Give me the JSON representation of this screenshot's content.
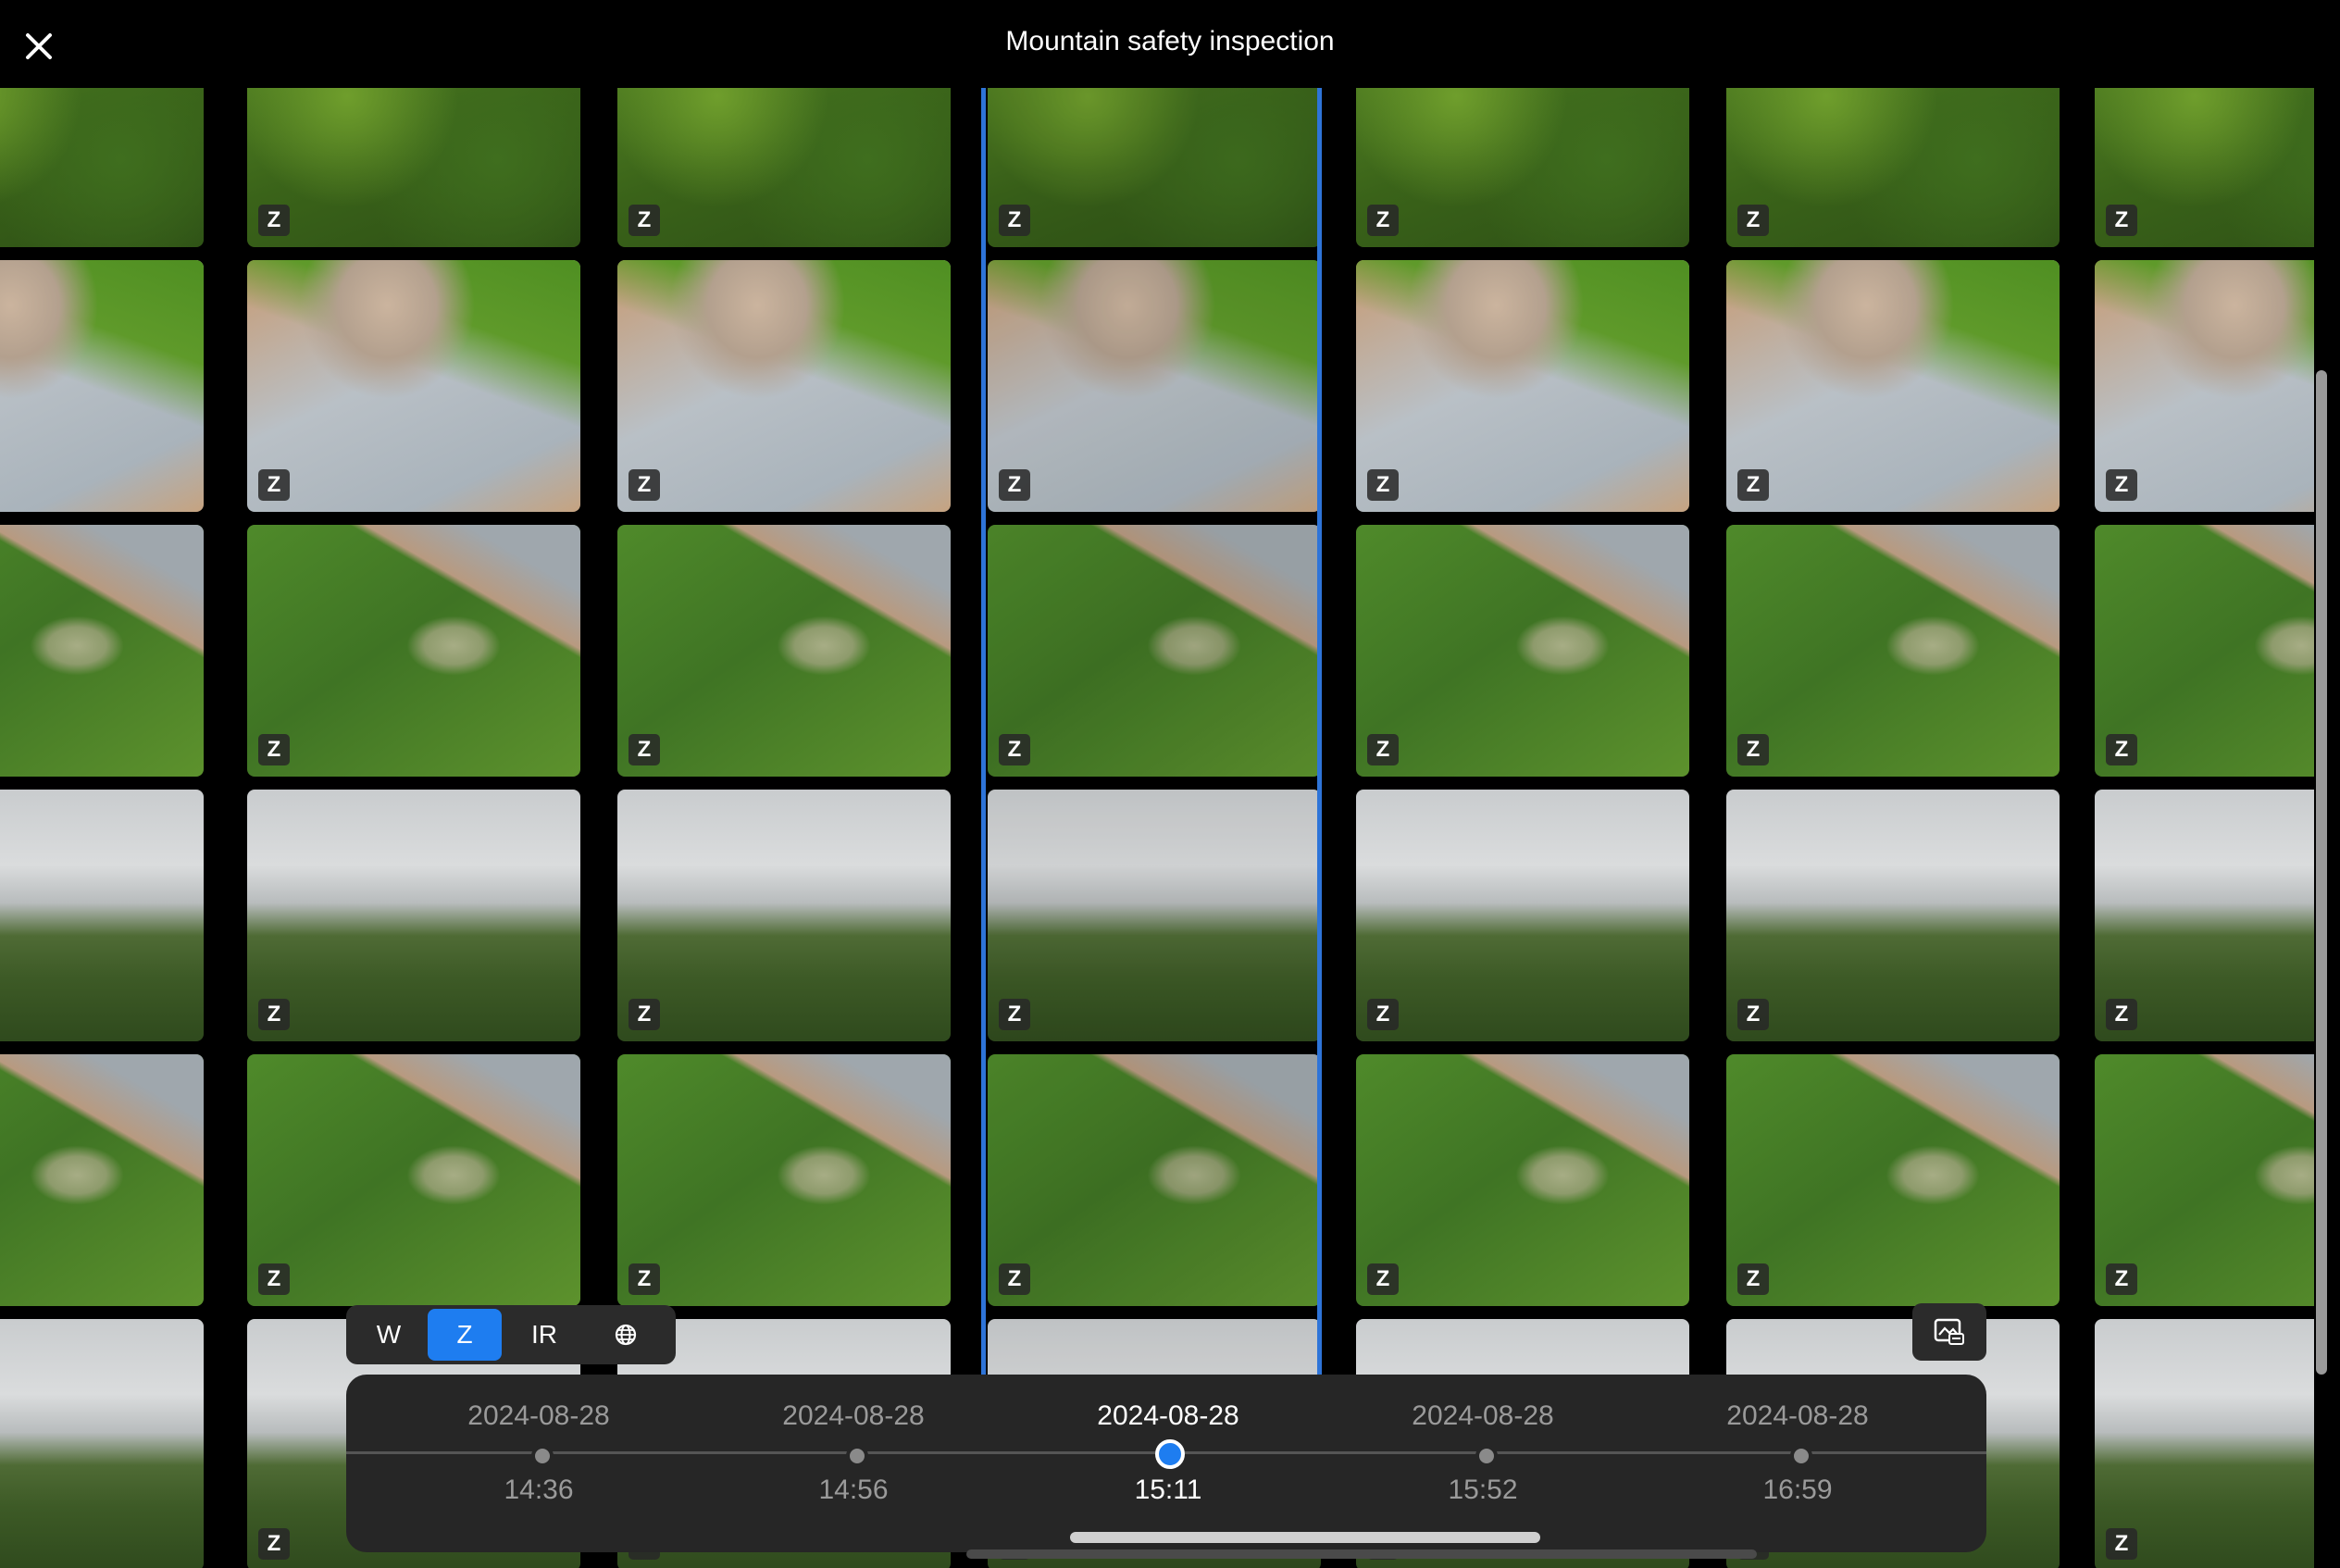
{
  "header": {
    "title": "Mountain safety inspection"
  },
  "icons": {
    "close": "close-icon",
    "compare": "compare-icon",
    "globe": "globe-icon"
  },
  "colors": {
    "accent": "#1e7df0",
    "selection": "#2e74d8",
    "background": "#000000",
    "panel": "#262626"
  },
  "grid": {
    "tile_label": "Z",
    "columns": 7,
    "selected_column": 3,
    "rows": [
      {
        "scene": "forest"
      },
      {
        "scene": "quarry"
      },
      {
        "scene": "pond"
      },
      {
        "scene": "sky"
      },
      {
        "scene": "pond"
      },
      {
        "scene": "sky"
      }
    ]
  },
  "lens": {
    "options": [
      {
        "label": "W",
        "active": false
      },
      {
        "label": "Z",
        "active": true
      },
      {
        "label": "IR",
        "active": false
      }
    ]
  },
  "timeline": {
    "items": [
      {
        "date": "2024-08-28",
        "time": "14:36",
        "active": false
      },
      {
        "date": "2024-08-28",
        "time": "14:56",
        "active": false
      },
      {
        "date": "2024-08-28",
        "time": "15:11",
        "active": true
      },
      {
        "date": "2024-08-28",
        "time": "15:52",
        "active": false
      },
      {
        "date": "2024-08-28",
        "time": "16:59",
        "active": false
      }
    ]
  }
}
